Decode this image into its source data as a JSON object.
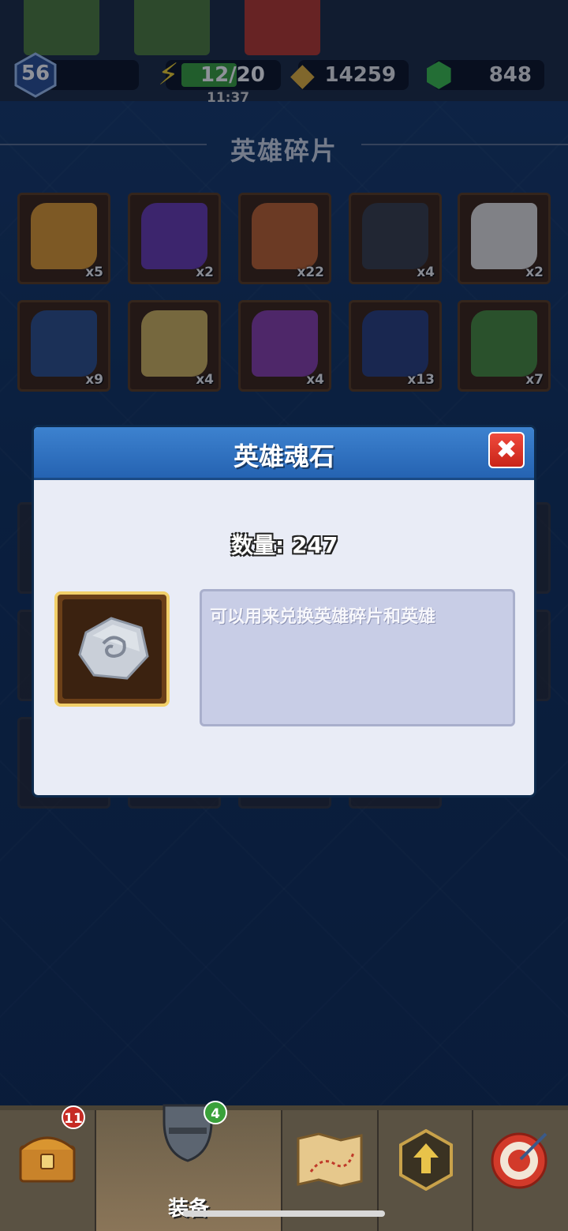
{
  "top": {
    "level": "56",
    "energy": "12/20",
    "timer": "11:37",
    "gold": "14259",
    "gems": "848"
  },
  "section_title": "英雄碎片",
  "shards": [
    {
      "count": "x5",
      "color": "#e19a2c"
    },
    {
      "count": "x2",
      "color": "#6a3bb0"
    },
    {
      "count": "x22",
      "color": "#c0622a"
    },
    {
      "count": "x4",
      "color": "#3a3d45"
    },
    {
      "count": "x2",
      "color": "#e6e2dc"
    },
    {
      "count": "x9",
      "color": "#2f4f88"
    },
    {
      "count": "x4",
      "color": "#d4b45a"
    },
    {
      "count": "x4",
      "color": "#8a3fa8"
    },
    {
      "count": "x13",
      "color": "#2a3f7a"
    },
    {
      "count": "x7",
      "color": "#4a8a3a"
    }
  ],
  "modal": {
    "title": "英雄魂石",
    "close_label": "✖",
    "quantity": "数量: 247",
    "description": "可以用来兑换英雄碎片和英雄"
  },
  "nav": {
    "chest_badge": "11",
    "equip_badge": "4",
    "equip_label": "装备"
  }
}
